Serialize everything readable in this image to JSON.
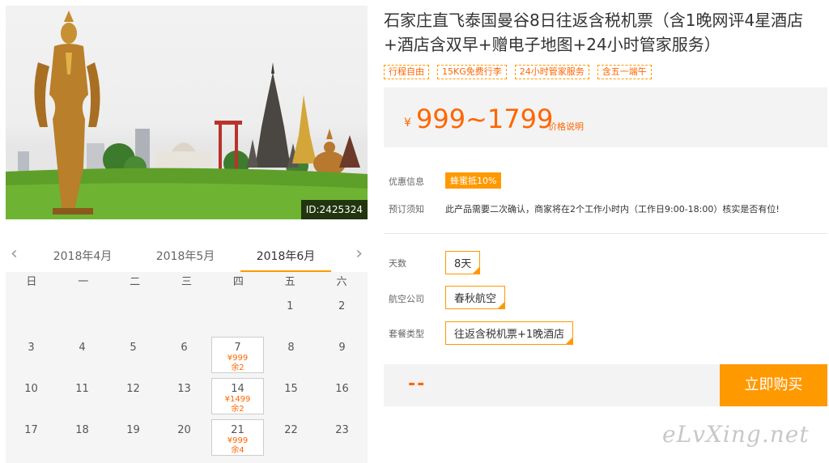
{
  "hero": {
    "id_tag": "ID:2425324"
  },
  "calendar": {
    "months": [
      "2018年4月",
      "2018年5月",
      "2018年6月"
    ],
    "weekdays": [
      "日",
      "一",
      "二",
      "三",
      "四",
      "五",
      "六"
    ],
    "rows": [
      [
        {
          "d": ""
        },
        {
          "d": ""
        },
        {
          "d": ""
        },
        {
          "d": ""
        },
        {
          "d": ""
        },
        {
          "d": "1"
        },
        {
          "d": "2"
        }
      ],
      [
        {
          "d": "3"
        },
        {
          "d": "4"
        },
        {
          "d": "5"
        },
        {
          "d": "6"
        },
        {
          "d": "7",
          "price": "¥999",
          "remain": "余2"
        },
        {
          "d": "8"
        },
        {
          "d": "9"
        }
      ],
      [
        {
          "d": "10"
        },
        {
          "d": "11"
        },
        {
          "d": "12"
        },
        {
          "d": "13"
        },
        {
          "d": "14",
          "price": "¥1499",
          "remain": "余2"
        },
        {
          "d": "15"
        },
        {
          "d": "16"
        }
      ],
      [
        {
          "d": "17"
        },
        {
          "d": "18"
        },
        {
          "d": "19"
        },
        {
          "d": "20"
        },
        {
          "d": "21",
          "price": "¥999",
          "remain": "余4"
        },
        {
          "d": "22"
        },
        {
          "d": "23"
        }
      ]
    ]
  },
  "product": {
    "title": "石家庄直飞泰国曼谷8日往返含税机票（含1晚网评4星酒店+酒店含双早+赠电子地图+24小时管家服务）",
    "tags": [
      "行程自由",
      "15KG免费行李",
      "24小时管家服务",
      "含五一端午"
    ],
    "currency": "¥",
    "price_range": "999~1799",
    "price_note": "价格说明"
  },
  "info": {
    "promo_label": "优惠信息",
    "promo_value": "蜂蜜抵10%",
    "notice_label": "预订须知",
    "notice_value": "此产品需要二次确认，商家将在2个工作小时内（工作日9:00-18:00）核实是否有位!"
  },
  "options": {
    "days_label": "天数",
    "days_value": "8天",
    "airline_label": "航空公司",
    "airline_value": "春秋航空",
    "package_label": "套餐类型",
    "package_value": "往返含税机票+1晚酒店"
  },
  "buy": {
    "total": "--",
    "button": "立即购买"
  },
  "watermark": "eLvXing.net",
  "colors": {
    "accent": "#ff9900",
    "price": "#ff6600"
  }
}
